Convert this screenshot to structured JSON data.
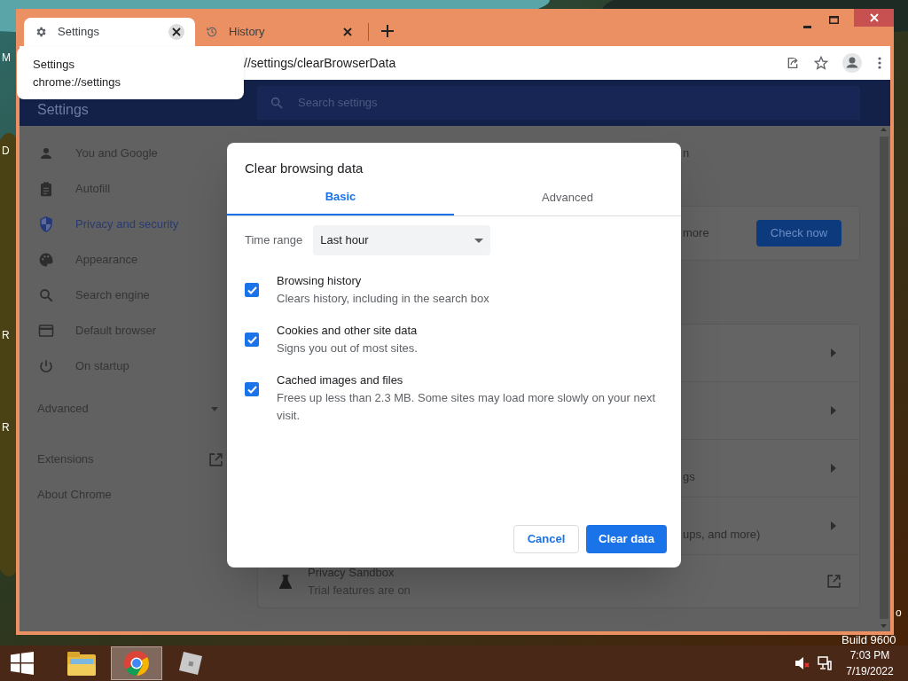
{
  "desktop": {
    "icon_labels": [
      "M",
      "D",
      "R",
      "R"
    ],
    "edge_text": "o",
    "build_label": "Build 9600"
  },
  "browser": {
    "tabs": [
      {
        "title": "Settings",
        "selected": true
      },
      {
        "title": "History",
        "selected": false
      }
    ],
    "tab_tooltip": {
      "title": "Settings",
      "url": "chrome://settings"
    },
    "address": "//settings/clearBrowserData",
    "settings": {
      "title": "Settings",
      "search_placeholder": "Search settings",
      "sidebar": [
        {
          "label": "You and Google",
          "selected": false
        },
        {
          "label": "Autofill",
          "selected": false
        },
        {
          "label": "Privacy and security",
          "selected": true
        },
        {
          "label": "Appearance",
          "selected": false
        },
        {
          "label": "Search engine",
          "selected": false
        },
        {
          "label": "Default browser",
          "selected": false
        },
        {
          "label": "On startup",
          "selected": false
        }
      ],
      "advanced": {
        "label": "Advanced",
        "expanded": false
      },
      "links": [
        {
          "label": "Extensions",
          "external": true
        },
        {
          "label": "About Chrome",
          "external": false
        }
      ],
      "top_fragment": "n",
      "safety_card": {
        "fragment": "more",
        "button": "Check now"
      },
      "rows": [
        {
          "kind": "arrow"
        },
        {
          "kind": "arrow"
        },
        {
          "kind": "arrow",
          "fragment": "gs"
        },
        {
          "kind": "arrow",
          "fragment": "ups, and more)"
        },
        {
          "kind": "external",
          "title": "Privacy Sandbox",
          "subtitle": "Trial features are on"
        }
      ]
    },
    "dialog": {
      "title": "Clear browsing data",
      "tabs": [
        {
          "label": "Basic",
          "selected": true
        },
        {
          "label": "Advanced",
          "selected": false
        }
      ],
      "time_range": {
        "label": "Time range",
        "value": "Last hour"
      },
      "items": [
        {
          "title": "Browsing history",
          "subtitle": "Clears history, including in the search box",
          "checked": true
        },
        {
          "title": "Cookies and other site data",
          "subtitle": "Signs you out of most sites.",
          "checked": true
        },
        {
          "title": "Cached images and files",
          "subtitle": "Frees up less than 2.3 MB. Some sites may load more slowly on your next visit.",
          "checked": true
        }
      ],
      "cancel": "Cancel",
      "confirm": "Clear data"
    }
  },
  "taskbar": {
    "apps": [
      {
        "kind": "explorer",
        "selected": false
      },
      {
        "kind": "chrome",
        "selected": true
      },
      {
        "kind": "roblox",
        "selected": false
      }
    ],
    "time": "7:03 PM",
    "date": "7/19/2022"
  }
}
